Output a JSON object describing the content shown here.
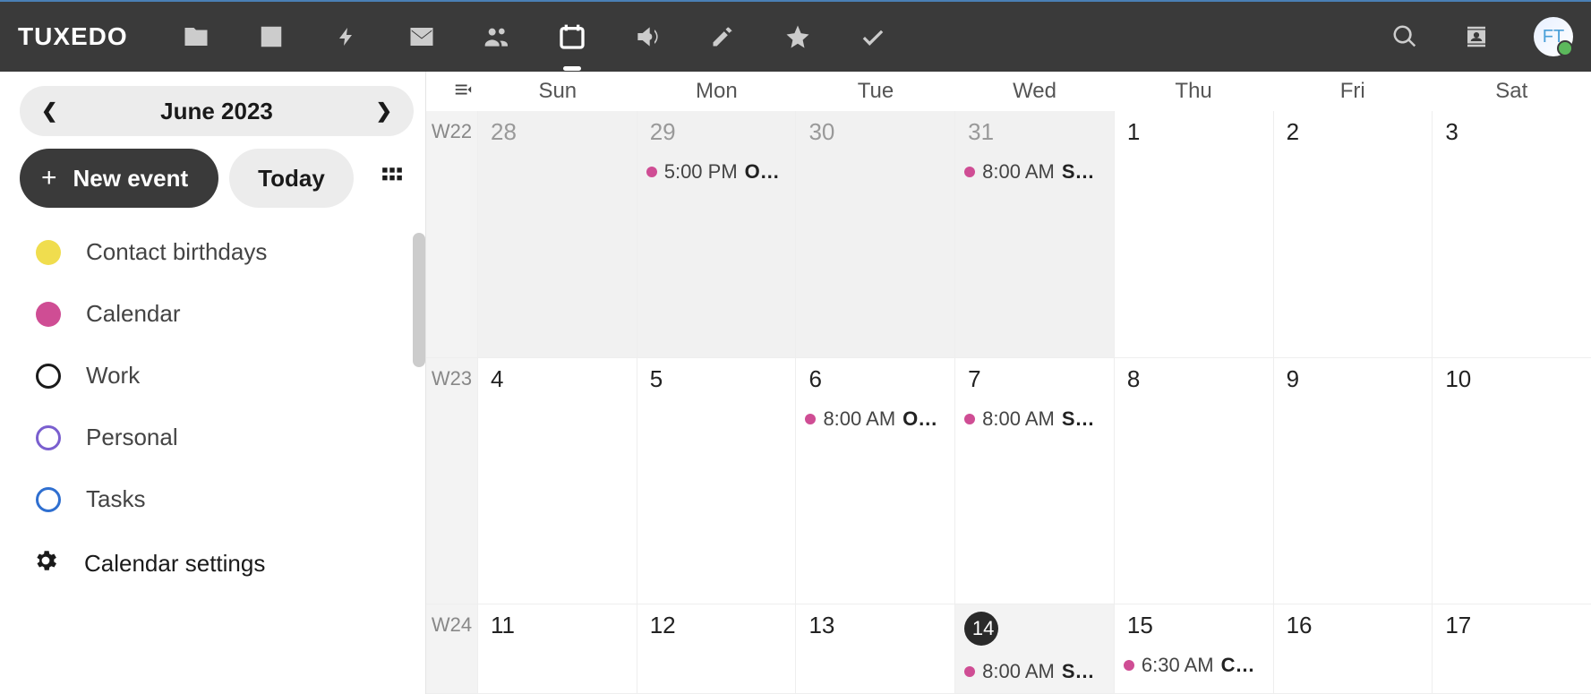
{
  "brand": "TUXEDO",
  "avatar_initials": "FT",
  "sidebar": {
    "month_label": "June 2023",
    "new_event": "New event",
    "today": "Today",
    "calendars": [
      {
        "label": "Contact birthdays",
        "color": "#f0dd4e",
        "filled": true
      },
      {
        "label": "Calendar",
        "color": "#cf4d94",
        "filled": true
      },
      {
        "label": "Work",
        "color": "#1a1a1a",
        "filled": false
      },
      {
        "label": "Personal",
        "color": "#7a5fcf",
        "filled": false
      },
      {
        "label": "Tasks",
        "color": "#2f6fd0",
        "filled": false
      }
    ],
    "settings": "Calendar settings"
  },
  "day_headers": [
    "Sun",
    "Mon",
    "Tue",
    "Wed",
    "Thu",
    "Fri",
    "Sat"
  ],
  "weeks": [
    {
      "wk": "W22",
      "days": [
        {
          "n": "28",
          "other": true
        },
        {
          "n": "29",
          "other": true,
          "events": [
            {
              "time": "5:00 PM",
              "title": "O…",
              "color": "#cf4d94"
            }
          ]
        },
        {
          "n": "30",
          "other": true
        },
        {
          "n": "31",
          "other": true,
          "events": [
            {
              "time": "8:00 AM",
              "title": "S…",
              "color": "#cf4d94"
            }
          ]
        },
        {
          "n": "1"
        },
        {
          "n": "2"
        },
        {
          "n": "3"
        }
      ]
    },
    {
      "wk": "W23",
      "days": [
        {
          "n": "4"
        },
        {
          "n": "5"
        },
        {
          "n": "6",
          "events": [
            {
              "time": "8:00 AM",
              "title": "O…",
              "color": "#cf4d94"
            }
          ]
        },
        {
          "n": "7",
          "events": [
            {
              "time": "8:00 AM",
              "title": "S…",
              "color": "#cf4d94"
            }
          ]
        },
        {
          "n": "8"
        },
        {
          "n": "9"
        },
        {
          "n": "10"
        }
      ]
    },
    {
      "wk": "W24",
      "days": [
        {
          "n": "11"
        },
        {
          "n": "12"
        },
        {
          "n": "13"
        },
        {
          "n": "14",
          "today": true,
          "events": [
            {
              "time": "8:00 AM",
              "title": "S…",
              "color": "#cf4d94"
            }
          ]
        },
        {
          "n": "15",
          "events": [
            {
              "time": "6:30 AM",
              "title": "C…",
              "color": "#cf4d94"
            }
          ]
        },
        {
          "n": "16"
        },
        {
          "n": "17"
        }
      ]
    }
  ]
}
